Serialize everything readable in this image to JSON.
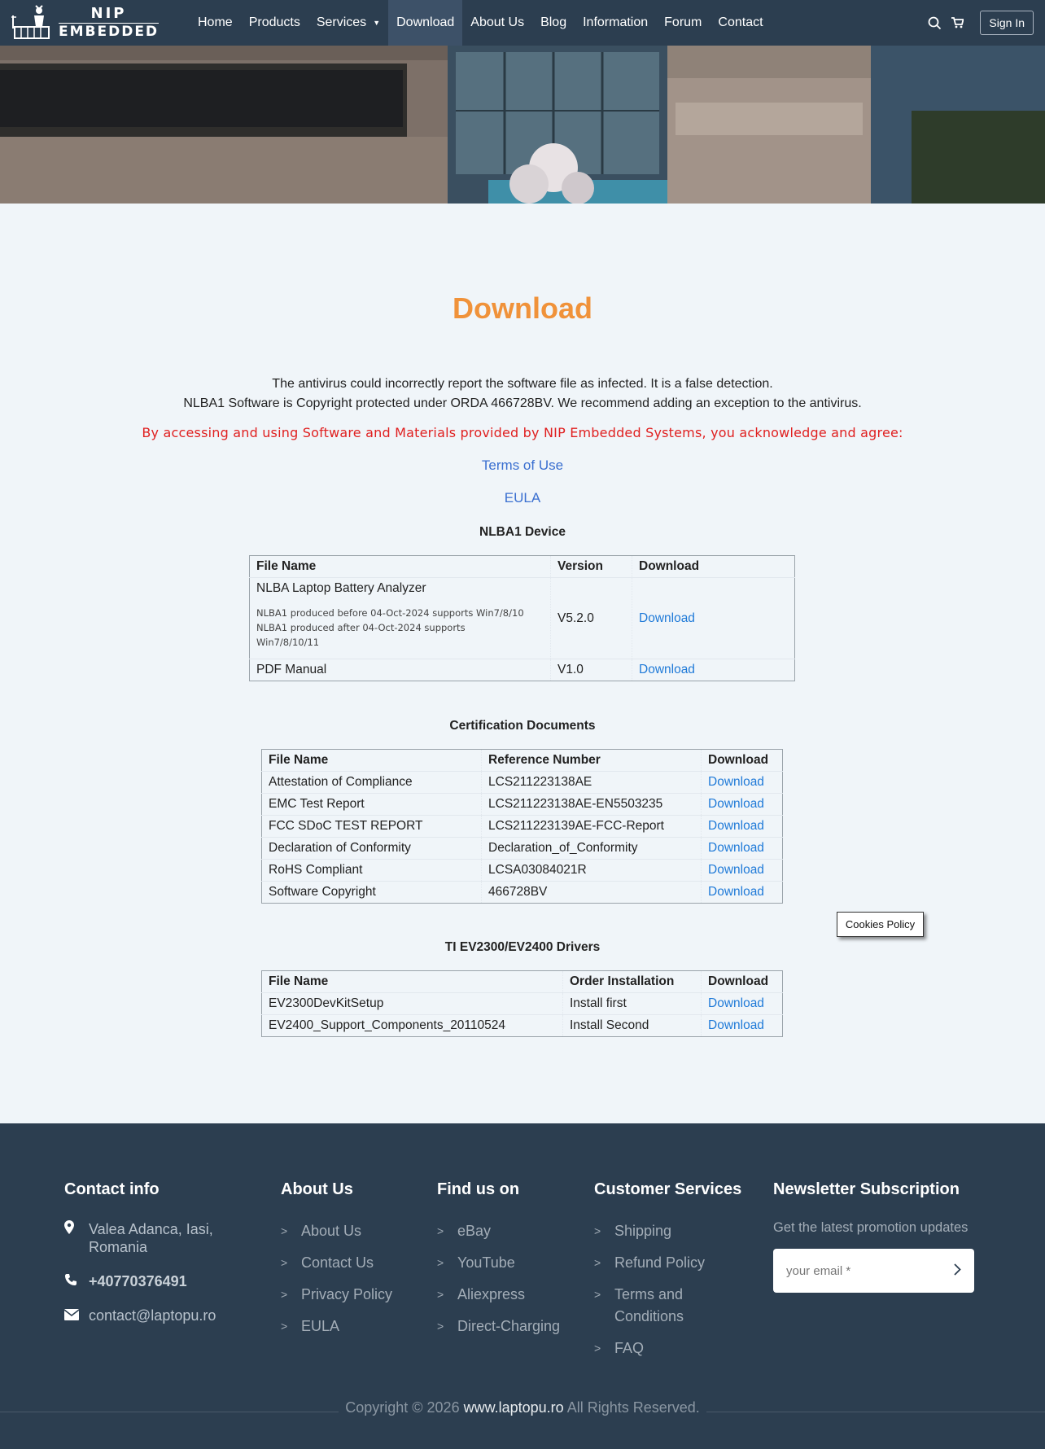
{
  "brand": {
    "line1": "NIP",
    "line2": "EMBEDDED"
  },
  "nav": {
    "items": [
      {
        "label": "Home"
      },
      {
        "label": "Products"
      },
      {
        "label": "Services"
      },
      {
        "label": "Download"
      },
      {
        "label": "About Us"
      },
      {
        "label": "Blog"
      },
      {
        "label": "Information"
      },
      {
        "label": "Forum"
      },
      {
        "label": "Contact"
      }
    ],
    "active": "Download",
    "sign_in": "Sign In"
  },
  "main": {
    "title": "Download",
    "notice_line1": "The antivirus could incorrectly report the software file as infected. It is a false detection.",
    "notice_line2": "NLBA1 Software is Copyright protected under ORDA 466728BV. We recommend adding an exception to the antivirus.",
    "agree": "By accessing and using Software and Materials provided by NIP Embedded Systems, you acknowledge and agree:",
    "terms": "Terms of Use",
    "eula": "EULA"
  },
  "device": {
    "title": "NLBA1 Device",
    "headers": [
      "File Name",
      "Version",
      "Download"
    ],
    "software": {
      "name": "NLBA Laptop Battery Analyzer",
      "note1": "NLBA1 produced before 04-Oct-2024 supports Win7/8/10",
      "note2": "NLBA1 produced after    04-Oct-2024 supports",
      "note3": "Win7/8/10/11",
      "version": "V5.2.0",
      "download": "Download"
    },
    "manual": {
      "name": "PDF Manual",
      "version": "V1.0",
      "download": "Download"
    }
  },
  "certs": {
    "title": "Certification Documents",
    "headers": [
      "File Name",
      "Reference Number",
      "Download"
    ],
    "rows": [
      {
        "name": "Attestation of Compliance",
        "ref": "LCS211223138AE",
        "download": "Download"
      },
      {
        "name": "EMC Test Report",
        "ref": "LCS211223138AE-EN5503235",
        "download": "Download"
      },
      {
        "name": "FCC SDoC TEST REPORT",
        "ref": "LCS211223139AE-FCC-Report",
        "download": "Download"
      },
      {
        "name": "Declaration of Conformity",
        "ref": "Declaration_of_Conformity",
        "download": "Download"
      },
      {
        "name": "RoHS Compliant",
        "ref": "LCSA03084021R",
        "download": "Download"
      },
      {
        "name": "Software Copyright",
        "ref": "466728BV",
        "download": "Download"
      }
    ]
  },
  "drivers": {
    "title": "TI EV2300/EV2400 Drivers",
    "headers": [
      "File Name",
      "Order Installation",
      "Download"
    ],
    "rows": [
      {
        "name": "EV2300DevKitSetup",
        "order": "Install first",
        "download": "Download"
      },
      {
        "name": "EV2400_Support_Components_20110524",
        "order": "Install Second",
        "download": "Download"
      }
    ]
  },
  "cookies": "Cookies Policy",
  "footer": {
    "contact": {
      "title": "Contact info",
      "address_line1": "Valea Adanca, Iasi,",
      "address_line2": "Romania",
      "phone": "+40770376491",
      "email": "contact@laptopu.ro"
    },
    "about": {
      "title": "About Us",
      "links": [
        "About Us",
        "Contact Us",
        "Privacy Policy",
        "EULA"
      ]
    },
    "find": {
      "title": "Find us on",
      "links": [
        "eBay",
        "YouTube",
        "Aliexpress",
        "Direct-Charging"
      ]
    },
    "services": {
      "title": "Customer Services",
      "links": [
        "Shipping",
        "Refund Policy",
        "Terms and Conditions",
        "FAQ"
      ]
    },
    "newsletter": {
      "title": "Newsletter Subscription",
      "subtitle": "Get the latest promotion updates",
      "placeholder": "your email *"
    },
    "copyright_prefix": "Copyright © 2026",
    "copyright_site": "www.laptopu.ro",
    "copyright_suffix": "All Rights Reserved."
  },
  "colors": {
    "nav_bg": "#2c3e50",
    "accent": "#f0923a",
    "warning": "#e02020",
    "link": "#1f7ad8"
  }
}
